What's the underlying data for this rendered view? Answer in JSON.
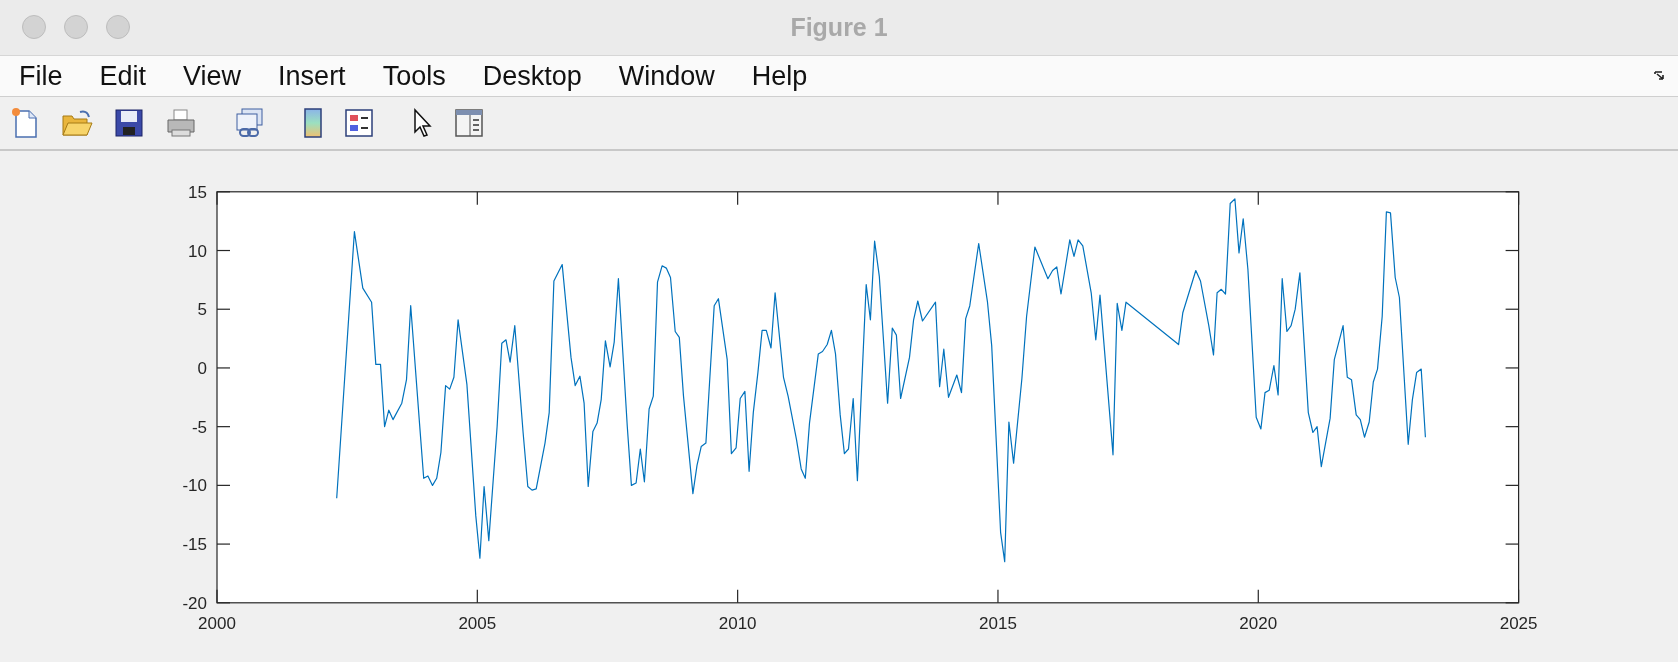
{
  "window": {
    "title": "Figure 1"
  },
  "menu": [
    "File",
    "Edit",
    "View",
    "Insert",
    "Tools",
    "Desktop",
    "Window",
    "Help"
  ],
  "figure": {
    "chart_data": {
      "type": "line",
      "xlim": [
        2000,
        2025
      ],
      "ylim": [
        -20,
        15
      ],
      "xticks": [
        2000,
        2005,
        2010,
        2015,
        2020,
        2025
      ],
      "yticks": [
        -20,
        -15,
        -10,
        -5,
        0,
        5,
        10,
        15
      ],
      "x": [
        2002.3,
        2002.64,
        2002.8,
        2002.97,
        2003.05,
        2003.14,
        2003.22,
        2003.3,
        2003.38,
        2003.55,
        2003.64,
        2003.72,
        2003.89,
        2003.97,
        2004.05,
        2004.14,
        2004.22,
        2004.3,
        2004.39,
        2004.47,
        2004.55,
        2004.63,
        2004.8,
        2004.97,
        2005.05,
        2005.13,
        2005.22,
        2005.38,
        2005.47,
        2005.55,
        2005.63,
        2005.72,
        2005.88,
        2005.97,
        2006.05,
        2006.13,
        2006.3,
        2006.38,
        2006.47,
        2006.63,
        2006.8,
        2006.88,
        2006.97,
        2007.05,
        2007.13,
        2007.22,
        2007.3,
        2007.38,
        2007.46,
        2007.55,
        2007.63,
        2007.71,
        2007.88,
        2007.96,
        2008.05,
        2008.13,
        2008.21,
        2008.3,
        2008.38,
        2008.46,
        2008.55,
        2008.63,
        2008.71,
        2008.8,
        2008.88,
        2008.96,
        2009.14,
        2009.22,
        2009.3,
        2009.39,
        2009.55,
        2009.63,
        2009.8,
        2009.88,
        2009.97,
        2010.05,
        2010.14,
        2010.22,
        2010.3,
        2010.39,
        2010.47,
        2010.55,
        2010.64,
        2010.72,
        2010.88,
        2010.97,
        2011.13,
        2011.22,
        2011.3,
        2011.38,
        2011.55,
        2011.63,
        2011.72,
        2011.8,
        2011.88,
        2011.97,
        2012.05,
        2012.13,
        2012.22,
        2012.3,
        2012.47,
        2012.55,
        2012.63,
        2012.72,
        2012.88,
        2012.97,
        2013.05,
        2013.13,
        2013.3,
        2013.38,
        2013.46,
        2013.55,
        2013.8,
        2013.88,
        2013.96,
        2014.05,
        2014.21,
        2014.3,
        2014.38,
        2014.46,
        2014.63,
        2014.8,
        2014.88,
        2015.05,
        2015.13,
        2015.21,
        2015.3,
        2015.46,
        2015.55,
        2015.71,
        2015.96,
        2016.05,
        2016.13,
        2016.21,
        2016.38,
        2016.46,
        2016.54,
        2016.63,
        2016.79,
        2016.88,
        2016.96,
        2017.21,
        2017.29,
        2017.38,
        2017.46,
        2018.47,
        2018.55,
        2018.8,
        2018.89,
        2019.05,
        2019.14,
        2019.21,
        2019.29,
        2019.37,
        2019.46,
        2019.55,
        2019.63,
        2019.71,
        2019.8,
        2019.96,
        2020.05,
        2020.13,
        2020.21,
        2020.3,
        2020.38,
        2020.46,
        2020.55,
        2020.63,
        2020.71,
        2020.8,
        2020.96,
        2021.05,
        2021.13,
        2021.21,
        2021.38,
        2021.46,
        2021.63,
        2021.71,
        2021.79,
        2021.88,
        2021.96,
        2022.04,
        2022.13,
        2022.21,
        2022.29,
        2022.38,
        2022.46,
        2022.54,
        2022.63,
        2022.71,
        2022.88,
        2022.96,
        2023.04,
        2023.13,
        2023.21
      ],
      "series": [
        {
          "color": "#0072bd",
          "values": [
            -11.1,
            11.6,
            6.8,
            5.6,
            0.3,
            0.3,
            -5.0,
            -3.6,
            -4.4,
            -3.0,
            -1.0,
            5.3,
            -4.7,
            -9.4,
            -9.2,
            -10.0,
            -9.4,
            -7.2,
            -1.5,
            -1.8,
            -0.8,
            4.1,
            -1.4,
            -12.6,
            -16.2,
            -10.1,
            -14.7,
            -5.0,
            2.1,
            2.4,
            0.5,
            3.6,
            -5.5,
            -10.1,
            -10.4,
            -10.3,
            -6.4,
            -3.8,
            7.4,
            8.8,
            0.9,
            -1.5,
            -0.7,
            -3.0,
            -10.1,
            -5.4,
            -4.7,
            -2.7,
            2.3,
            0.1,
            2.2,
            7.6,
            -5.0,
            -10.0,
            -9.8,
            -6.9,
            -9.7,
            -3.5,
            -2.4,
            7.3,
            8.7,
            8.5,
            7.7,
            3.1,
            2.6,
            -2.4,
            -10.7,
            -8.3,
            -6.7,
            -6.4,
            5.3,
            5.9,
            0.7,
            -7.3,
            -6.8,
            -2.6,
            -2.0,
            -8.8,
            -3.8,
            -0.4,
            3.2,
            3.2,
            1.7,
            6.4,
            -0.8,
            -2.4,
            -6.1,
            -8.6,
            -9.4,
            -4.7,
            1.2,
            1.4,
            2.0,
            3.2,
            1.2,
            -4.0,
            -7.3,
            -6.9,
            -2.6,
            -9.6,
            7.1,
            4.1,
            10.8,
            7.8,
            -3.0,
            3.4,
            2.8,
            -2.6,
            0.9,
            4.1,
            5.7,
            4.0,
            5.6,
            -1.6,
            1.6,
            -2.5,
            -0.6,
            -2.1,
            4.2,
            5.3,
            10.6,
            5.6,
            1.9,
            -14.0,
            -16.5,
            -4.6,
            -8.1,
            -0.9,
            4.4,
            10.3,
            7.6,
            8.3,
            8.6,
            6.3,
            10.9,
            9.5,
            10.9,
            10.4,
            6.4,
            2.4,
            6.2,
            -7.4,
            5.5,
            3.2,
            5.6,
            2.0,
            4.7,
            8.3,
            7.4,
            3.6,
            1.1,
            6.4,
            6.7,
            6.3,
            14.0,
            14.4,
            9.8,
            12.7,
            8.4,
            -4.2,
            -5.2,
            -2.1,
            -1.9,
            0.2,
            -2.3,
            7.6,
            3.1,
            3.6,
            5.0,
            8.1,
            -3.8,
            -5.5,
            -5.0,
            -8.4,
            -4.3,
            0.7,
            3.6,
            -0.8,
            -1.0,
            -4.0,
            -4.4,
            -5.9,
            -4.6,
            -1.2,
            -0.1,
            4.4,
            13.3,
            13.2,
            7.7,
            6.0,
            -6.5,
            -2.7,
            -0.4,
            -0.1,
            -5.9
          ]
        }
      ]
    }
  }
}
